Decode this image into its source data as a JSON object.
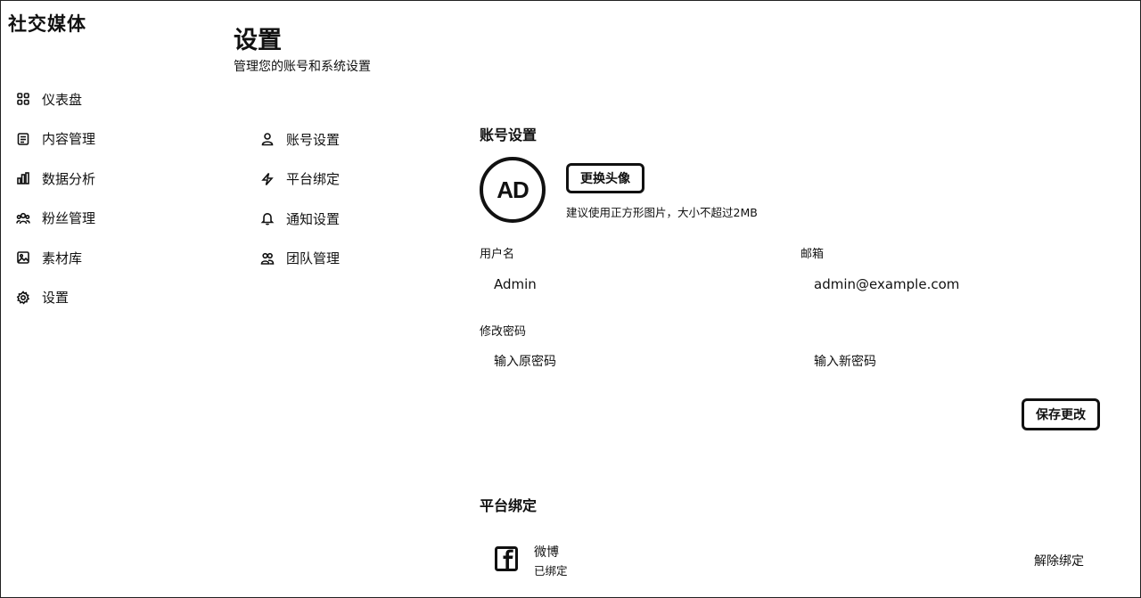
{
  "app": {
    "brand": "社交媒体"
  },
  "sidebar": {
    "items": [
      {
        "label": "仪表盘",
        "icon": "dashboard-grid-icon"
      },
      {
        "label": "内容管理",
        "icon": "content-icon"
      },
      {
        "label": "数据分析",
        "icon": "bar-chart-icon"
      },
      {
        "label": "粉丝管理",
        "icon": "users-icon"
      },
      {
        "label": "素材库",
        "icon": "image-icon"
      },
      {
        "label": "设置",
        "icon": "gear-icon"
      }
    ]
  },
  "page": {
    "title": "设置",
    "subtitle": "管理您的账号和系统设置"
  },
  "settings_nav": {
    "items": [
      {
        "label": "账号设置",
        "icon": "user-icon"
      },
      {
        "label": "平台绑定",
        "icon": "lightning-icon"
      },
      {
        "label": "通知设置",
        "icon": "bell-icon"
      },
      {
        "label": "团队管理",
        "icon": "team-icon"
      }
    ]
  },
  "account": {
    "title": "账号设置",
    "avatar_initials": "AD",
    "change_avatar_label": "更换头像",
    "avatar_hint": "建议使用正方形图片，大小不超过2MB",
    "username_label": "用户名",
    "username_value": "Admin",
    "email_label": "邮箱",
    "email_value": "admin@example.com",
    "password_label": "修改密码",
    "old_password_placeholder": "输入原密码",
    "new_password_placeholder": "输入新密码",
    "save_label": "保存更改"
  },
  "platforms": {
    "title": "平台绑定",
    "items": [
      {
        "name": "微博",
        "status": "已绑定",
        "action": "解除绑定",
        "icon": "facebook-icon"
      }
    ]
  }
}
